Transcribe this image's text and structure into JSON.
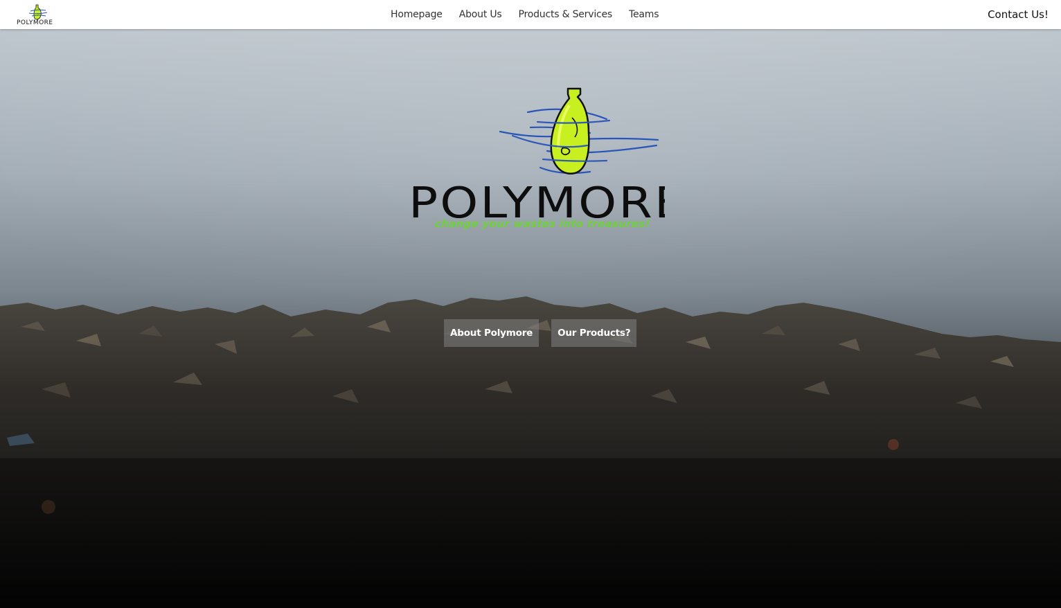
{
  "nav": {
    "logo_text": "POLYMORE",
    "links": [
      "Homepage",
      "About Us",
      "Products & Services",
      "Teams"
    ],
    "contact": "Contact Us!"
  },
  "hero": {
    "brand_text": "POLYMORE",
    "tagline": "change your wastes into treasures!",
    "buttons": [
      "About Polymore",
      "Our Products?"
    ]
  },
  "colors": {
    "tagline_green": "#6ed13a",
    "bottle_green": "#c8f020",
    "swirl_blue": "#2a55b8",
    "navbar_bg": "#ffffff"
  },
  "icons": {
    "logo": "bottle-logo-icon"
  }
}
